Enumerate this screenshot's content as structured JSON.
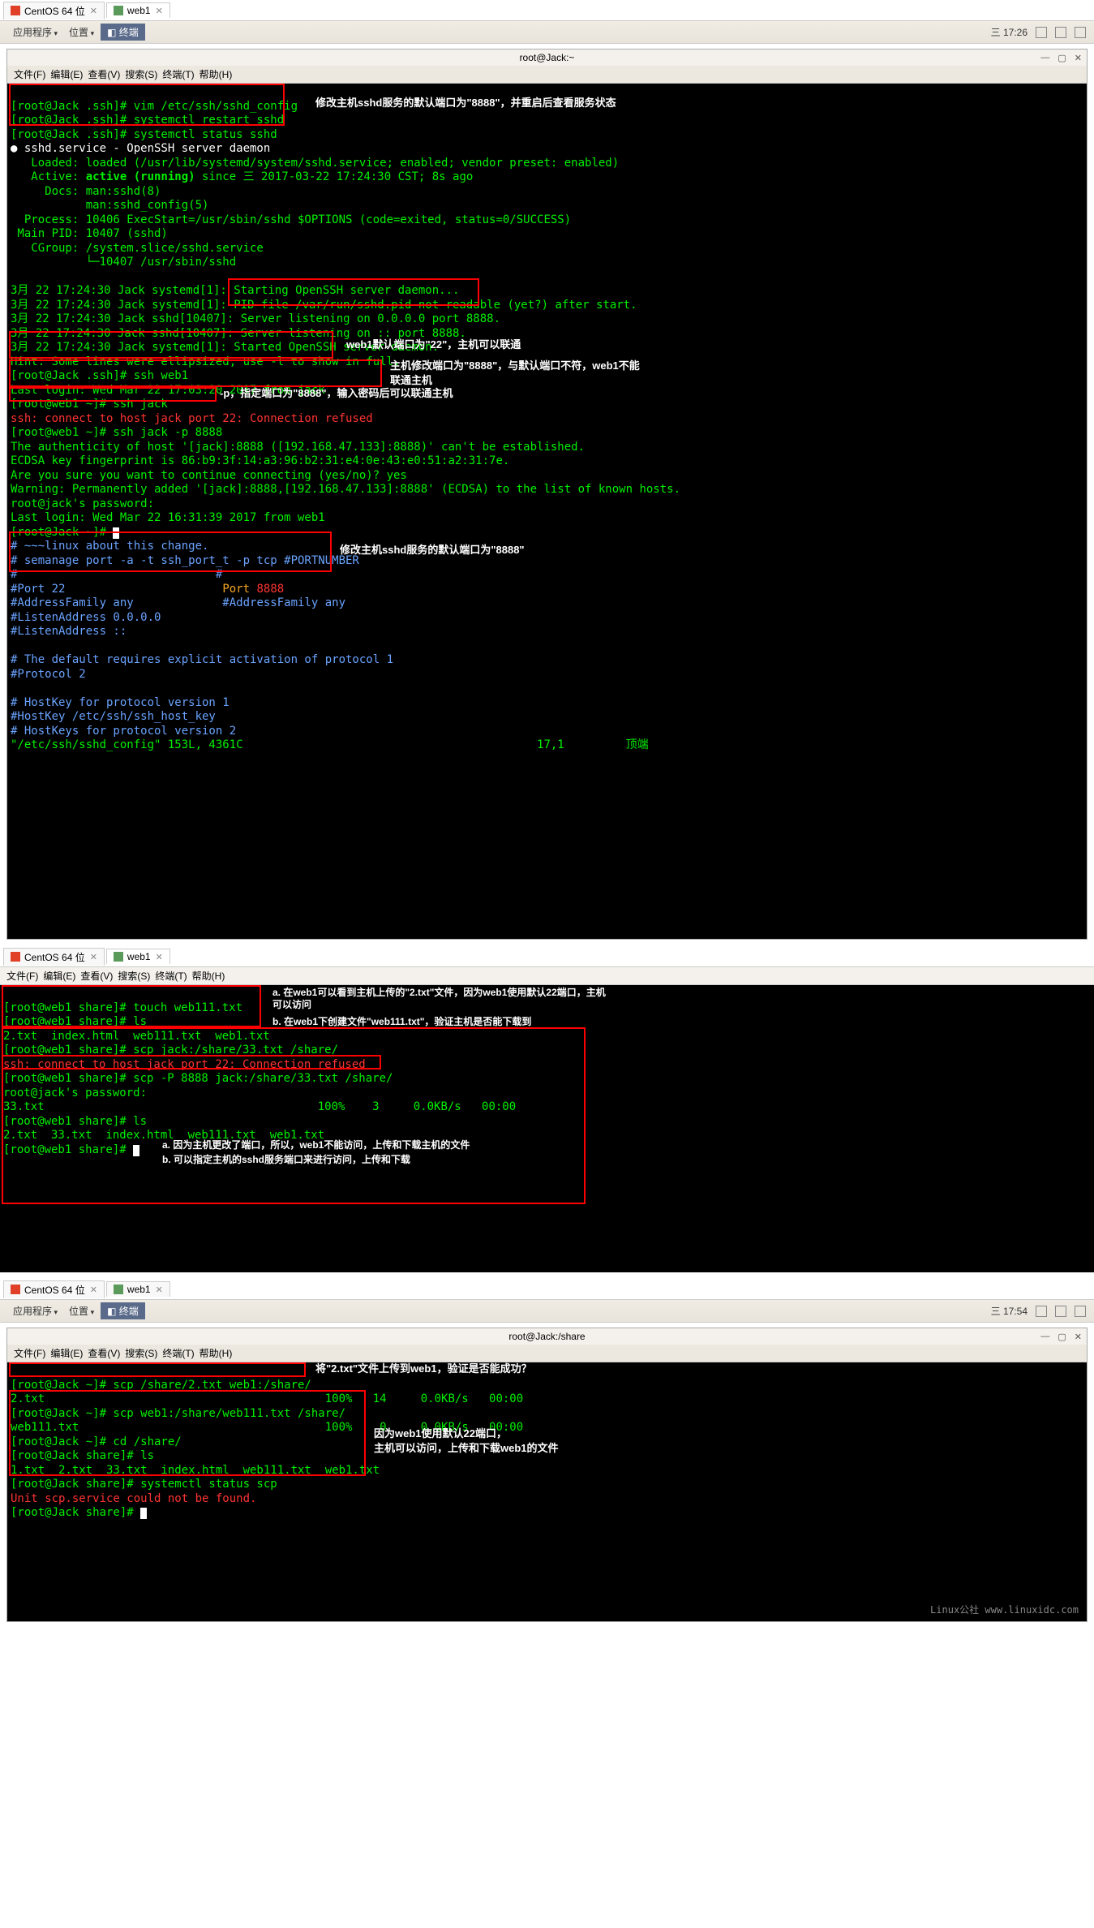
{
  "top": {
    "tabs": [
      {
        "label": "CentOS 64 位",
        "iconClass": "",
        "hasClose": true,
        "active": false
      },
      {
        "label": "web1",
        "iconClass": "green",
        "hasClose": true,
        "active": true
      }
    ],
    "gnome": {
      "apps": "应用程序",
      "location": "位置",
      "taskbar": "终端",
      "time": "三 17:26",
      "trayCount": 4
    },
    "window": {
      "title": "root@Jack:~",
      "menus": [
        "文件(F)",
        "编辑(E)",
        "查看(V)",
        "搜索(S)",
        "终端(T)",
        "帮助(H)"
      ]
    },
    "term": {
      "l1": "[root@Jack .ssh]# vim /etc/ssh/sshd_config",
      "l2": "[root@Jack .ssh]# systemctl restart sshd",
      "l3": "[root@Jack .ssh]# systemctl status sshd",
      "note1": "修改主机sshd服务的默认端口为\"8888\"，并重启后查看服务状态",
      "l4": "● sshd.service - OpenSSH server daemon",
      "l5": "   Loaded: loaded (/usr/lib/systemd/system/sshd.service; enabled; vendor preset: enabled)",
      "l6a": "   Active: ",
      "l6b": "active (running)",
      "l6c": " since 三 2017-03-22 17:24:30 CST; 8s ago",
      "l7": "     Docs: man:sshd(8)",
      "l8": "           man:sshd_config(5)",
      "l9": "  Process: 10406 ExecStart=/usr/sbin/sshd $OPTIONS (code=exited, status=0/SUCCESS)",
      "l10": " Main PID: 10407 (sshd)",
      "l11": "   CGroup: /system.slice/sshd.service",
      "l12": "           └─10407 /usr/sbin/sshd",
      "l13": "3月 22 17:24:30 Jack systemd[1]: Starting OpenSSH server daemon...",
      "l14": "3月 22 17:24:30 Jack systemd[1]: PID file /var/run/sshd.pid not readable (yet?) after start.",
      "l15": "3月 22 17:24:30 Jack sshd[10407]: Server listening on 0.0.0.0 port 8888.",
      "l16": "3月 22 17:24:30 Jack sshd[10407]: Server listening on :: port 8888.",
      "l17": "3月 22 17:24:30 Jack systemd[1]: Started OpenSSH server daemon.",
      "l18": "Hint: Some lines were ellipsized, use -l to show in full.",
      "l19": "[root@Jack .ssh]# ssh web1",
      "note2": "web1默认端口为\"22\"，主机可以联通",
      "l20": "Last login: Wed Mar 22 17:03:20 2017 from jack",
      "l21": "[root@web1 ~]# ssh jack",
      "note3a": "主机修改端口为\"8888\"，与默认端口不符，web1不能",
      "note3b": "联通主机",
      "l22": "ssh: connect to host jack port 22: Connection refused",
      "l23": "[root@web1 ~]# ssh jack -p 8888",
      "note4": "-p，指定端口为\"8888\"，输入密码后可以联通主机",
      "l24": "The authenticity of host '[jack]:8888 ([192.168.47.133]:8888)' can't be established.",
      "l25": "ECDSA key fingerprint is 86:b9:3f:14:a3:96:b2:31:e4:0e:43:e0:51:a2:31:7e.",
      "l26": "Are you sure you want to continue connecting (yes/no)? yes",
      "l27": "Warning: Permanently added '[jack]:8888,[192.168.47.133]:8888' (ECDSA) to the list of known hosts.",
      "l28": "root@jack's password: ",
      "l29": "Last login: Wed Mar 22 16:31:39 2017 from web1",
      "l30": "[root@Jack ~]# ",
      "c1": "# ~~~linux about this change.",
      "c2": "# semanage port -a -t ssh_port_t -p tcp #PORTNUMBER",
      "c3": "#",
      "c3r": "#",
      "c4": "#Port 22",
      "c4r_a": "Port ",
      "c4r_b": "8888",
      "note5": "修改主机sshd服务的默认端口为\"8888\"",
      "c5": "#AddressFamily any",
      "c5r": "#AddressFamily any",
      "c6": "#ListenAddress 0.0.0.0",
      "c7": "#ListenAddress ::",
      "c8": "# The default requires explicit activation of protocol 1",
      "c9": "#Protocol 2",
      "c10": "# HostKey for protocol version 1",
      "c11": "#HostKey /etc/ssh/ssh_host_key",
      "c12": "# HostKeys for protocol version 2",
      "c13": "\"/etc/ssh/sshd_config\" 153L, 4361C",
      "c13pos": "17,1",
      "c13end": "顶端"
    }
  },
  "mid": {
    "tabs": [
      {
        "label": "CentOS 64 位",
        "iconClass": "",
        "hasClose": true,
        "active": false
      },
      {
        "label": "web1",
        "iconClass": "green",
        "hasClose": true,
        "active": true
      }
    ],
    "menus": [
      "文件(F)",
      "编辑(E)",
      "查看(V)",
      "搜索(S)",
      "终端(T)",
      "帮助(H)"
    ],
    "term": {
      "l1": "[root@web1 share]# touch web111.txt",
      "l2": "[root@web1 share]# ls",
      "l3": "2.txt  index.html  web111.txt  web1.txt",
      "notea": "a. 在web1可以看到主机上传的\"2.txt\"文件，因为web1使用默认22端口，主机可以访问",
      "noteb": "b. 在web1下创建文件\"web111.txt\"，验证主机是否能下载到",
      "l4": "[root@web1 share]# scp jack:/share/33.txt /share/",
      "l5": "ssh: connect to host jack port 22: Connection refused",
      "l6": "[root@web1 share]# scp -P 8888 jack:/share/33.txt /share/",
      "l7": "root@jack's password: ",
      "l8": "33.txt                                        100%    3     0.0KB/s   00:00    ",
      "l9": "[root@web1 share]# ls",
      "l10": "2.txt  33.txt  index.html  web111.txt  web1.txt",
      "l11": "[root@web1 share]# ",
      "na": "a. 因为主机更改了端口，所以，web1不能访问，上传和下载主机的文件",
      "nb": "b. 可以指定主机的sshd服务端口来进行访问，上传和下载"
    }
  },
  "bot": {
    "tabs": [
      {
        "label": "CentOS 64 位",
        "iconClass": "",
        "hasClose": true,
        "active": false
      },
      {
        "label": "web1",
        "iconClass": "green",
        "hasClose": true,
        "active": false
      }
    ],
    "gnome": {
      "apps": "应用程序",
      "location": "位置",
      "taskbar": "终端",
      "time": "三 17:54",
      "trayCount": 4
    },
    "window": {
      "title": "root@Jack:/share",
      "menus": [
        "文件(F)",
        "编辑(E)",
        "查看(V)",
        "搜索(S)",
        "终端(T)",
        "帮助(H)"
      ]
    },
    "term": {
      "l1": "[root@Jack ~]# scp /share/2.txt web1:/share/",
      "note1": "将\"2.txt\"文件上传到web1，验证是否能成功？",
      "l2": "2.txt                                         100%   14     0.0KB/s   00:00    ",
      "l3": "[root@Jack ~]# scp web1:/share/web111.txt /share/",
      "l4": "web111.txt                                    100%    0     0.0KB/s   00:00    ",
      "l5": "[root@Jack ~]# cd /share/",
      "note2a": "因为web1使用默认22端口，",
      "note2b": "主机可以访问，上传和下载web1的文件",
      "l6": "[root@Jack share]# ls",
      "l7": "1.txt  2.txt  33.txt  index.html  web111.txt  web1.txt",
      "l8": "[root@Jack share]# systemctl status scp",
      "l9": "Unit scp.service could not be found.",
      "l10": "[root@Jack share]# "
    },
    "watermark": "Linux公社 www.linuxidc.com"
  }
}
